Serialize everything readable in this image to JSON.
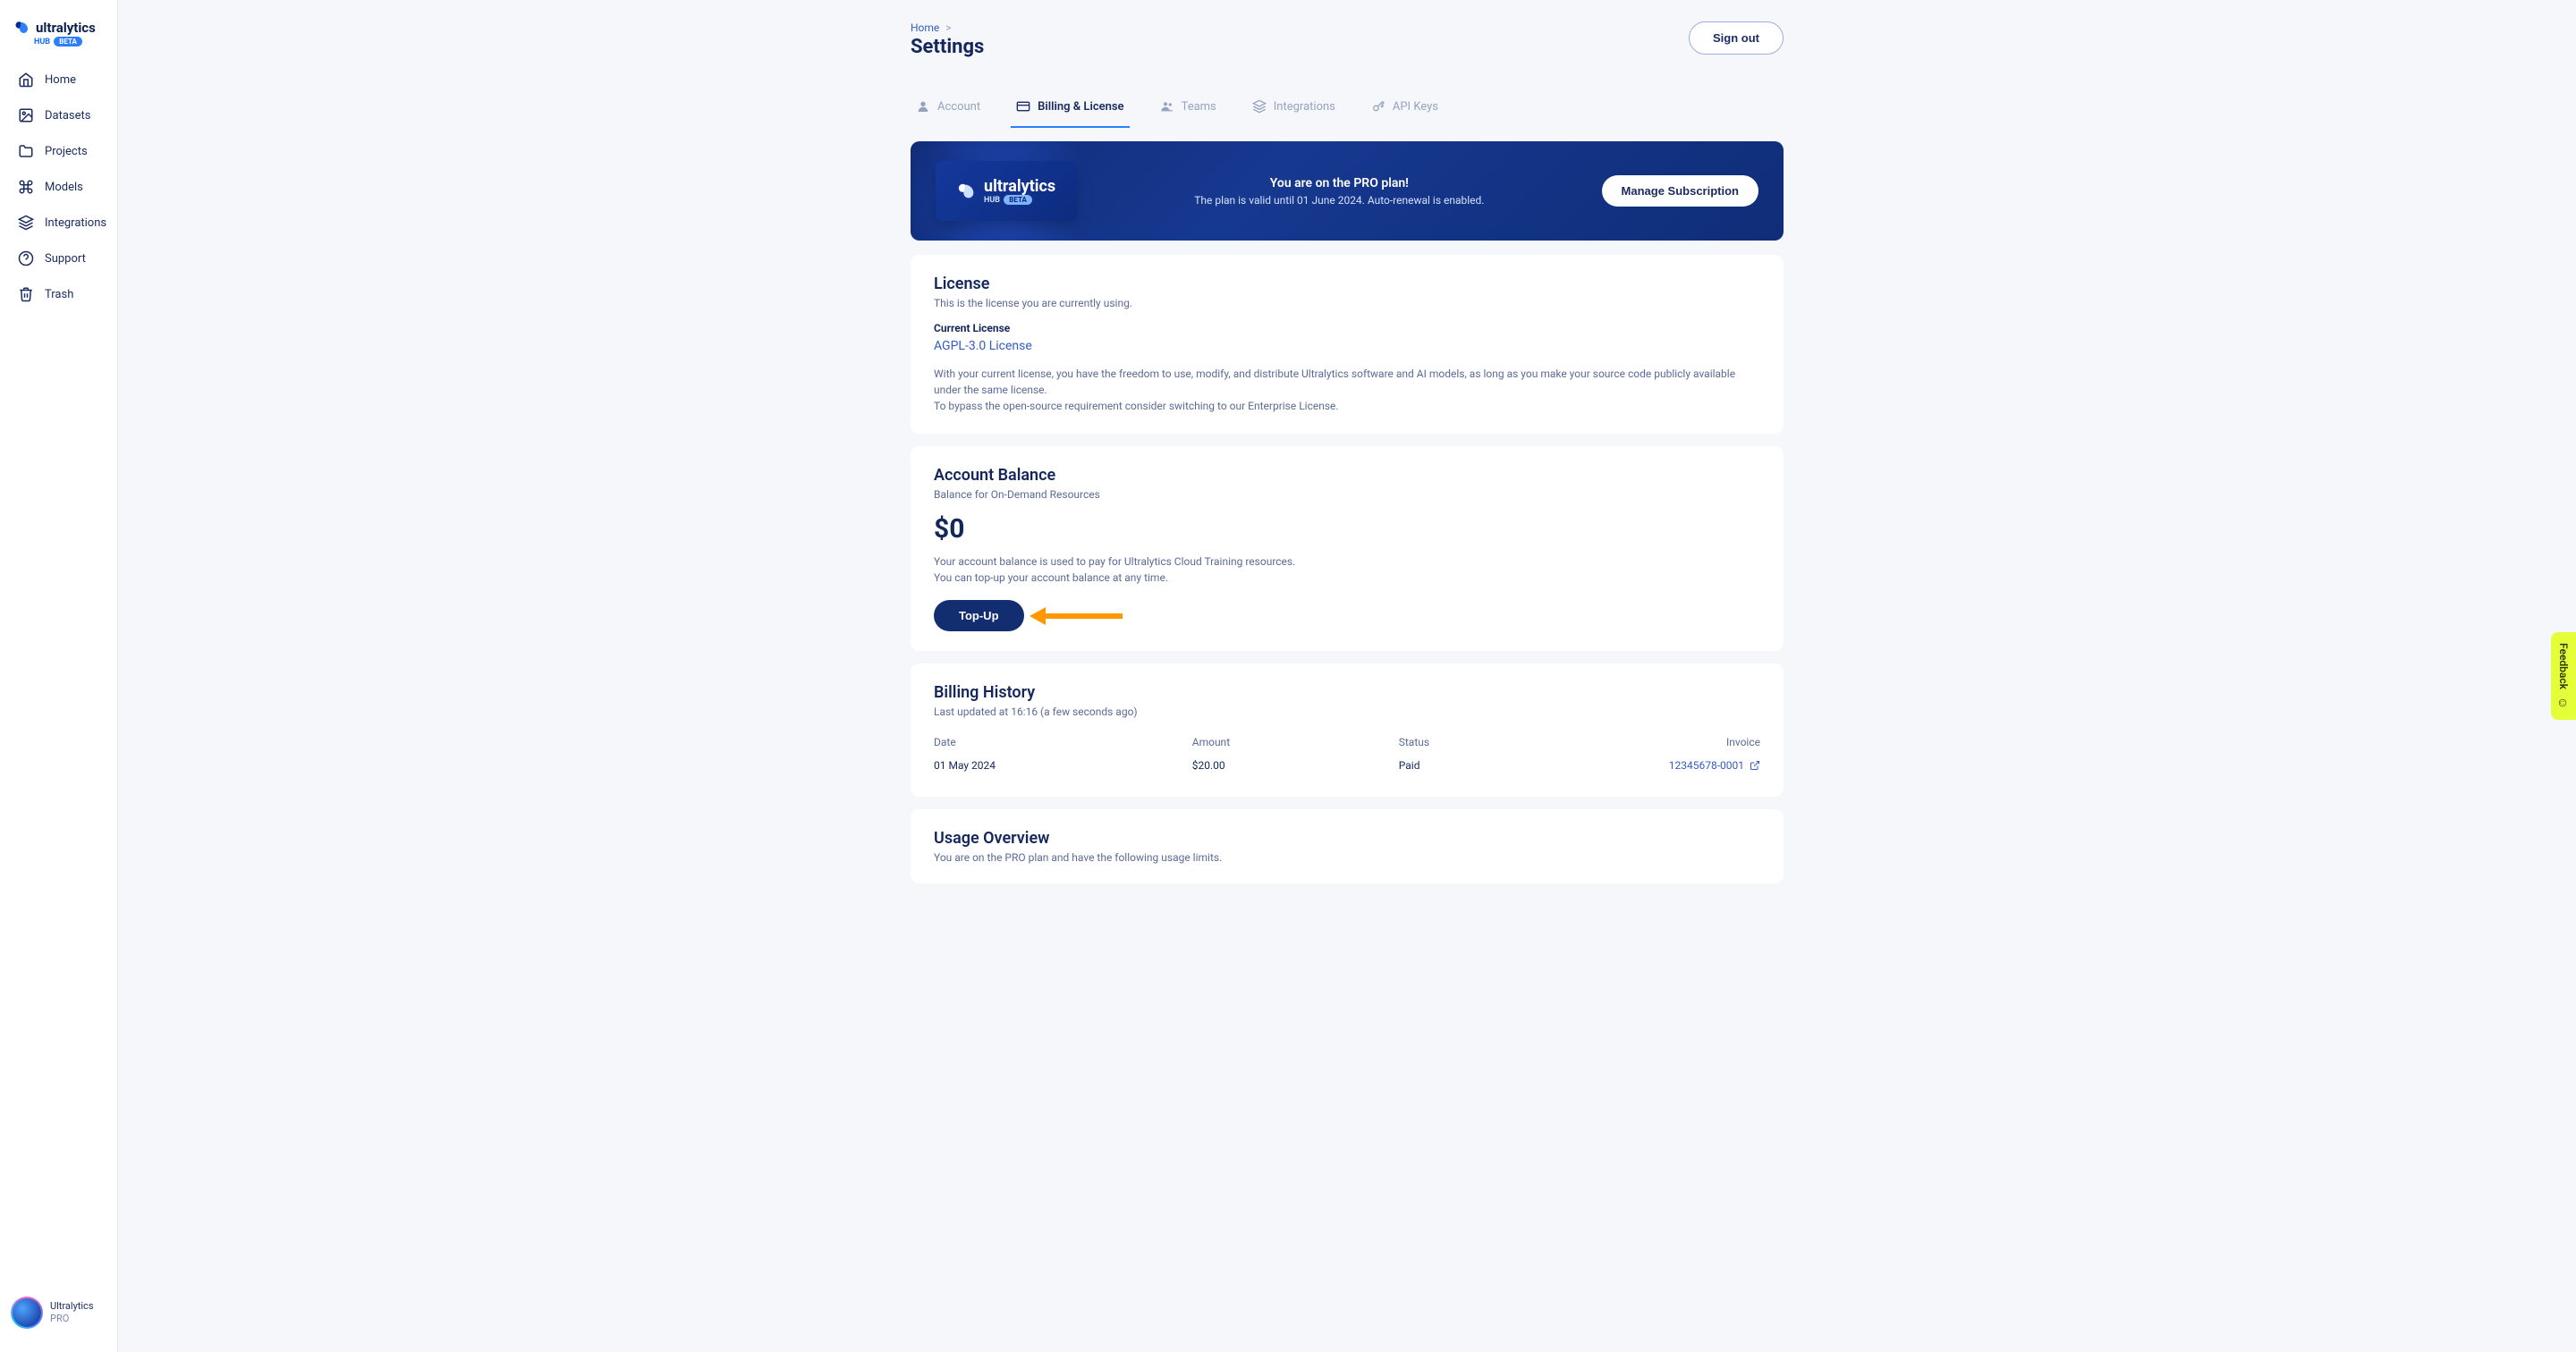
{
  "brand": {
    "name": "ultralytics",
    "sub": "HUB",
    "badge": "BETA"
  },
  "sidebar": {
    "items": [
      {
        "label": "Home",
        "icon": "home"
      },
      {
        "label": "Datasets",
        "icon": "image"
      },
      {
        "label": "Projects",
        "icon": "folder"
      },
      {
        "label": "Models",
        "icon": "command"
      },
      {
        "label": "Integrations",
        "icon": "layers"
      },
      {
        "label": "Support",
        "icon": "help"
      },
      {
        "label": "Trash",
        "icon": "trash"
      }
    ]
  },
  "user": {
    "name": "Ultralytics",
    "plan": "PRO"
  },
  "breadcrumb": {
    "home": "Home",
    "sep": ">"
  },
  "page": {
    "title": "Settings"
  },
  "actions": {
    "signout": "Sign out"
  },
  "tabs": [
    {
      "label": "Account",
      "icon": "user"
    },
    {
      "label": "Billing & License",
      "icon": "card"
    },
    {
      "label": "Teams",
      "icon": "group"
    },
    {
      "label": "Integrations",
      "icon": "layers"
    },
    {
      "label": "API Keys",
      "icon": "key"
    }
  ],
  "activeTab": 1,
  "banner": {
    "line1": "You are on the PRO plan!",
    "line2": "The plan is valid until 01 June 2024. Auto-renewal is enabled.",
    "manage": "Manage Subscription"
  },
  "license": {
    "title": "License",
    "sub": "This is the license you are currently using.",
    "currentLabel": "Current License",
    "link": "AGPL-3.0 License",
    "desc1": "With your current license, you have the freedom to use, modify, and distribute Ultralytics software and AI models, as long as you make your source code publicly available under the same license.",
    "desc2": "To bypass the open-source requirement consider switching to our Enterprise License."
  },
  "balance": {
    "title": "Account Balance",
    "sub": "Balance for On-Demand Resources",
    "amount": "$0",
    "desc1": "Your account balance is used to pay for Ultralytics Cloud Training resources.",
    "desc2": "You can top-up your account balance at any time.",
    "topup": "Top-Up"
  },
  "history": {
    "title": "Billing History",
    "sub": "Last updated at 16:16 (a few seconds ago)",
    "cols": {
      "date": "Date",
      "amount": "Amount",
      "status": "Status",
      "invoice": "Invoice"
    },
    "rows": [
      {
        "date": "01 May 2024",
        "amount": "$20.00",
        "status": "Paid",
        "invoice": "12345678-0001"
      }
    ]
  },
  "usage": {
    "title": "Usage Overview",
    "sub": "You are on the PRO plan and have the following usage limits."
  },
  "feedback": {
    "label": "Feedback"
  }
}
